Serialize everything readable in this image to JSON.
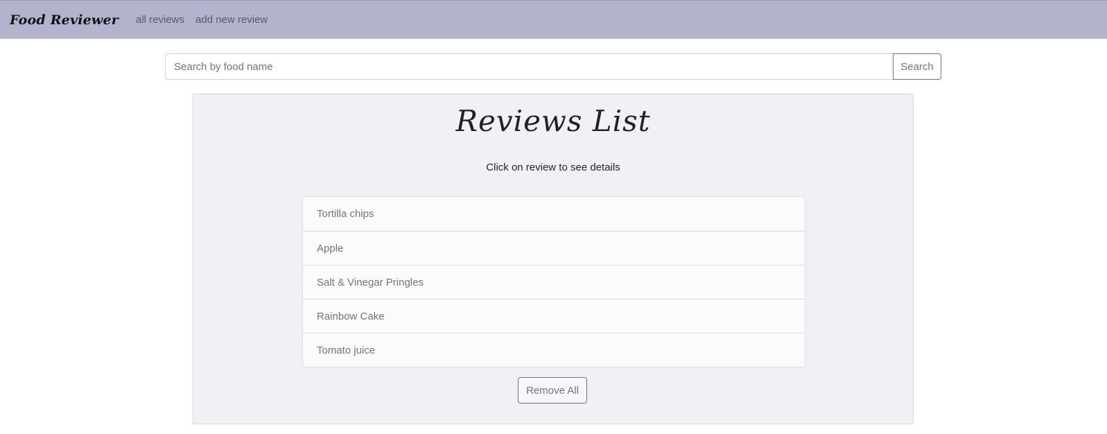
{
  "navbar": {
    "brand": "Food Reviewer",
    "links": [
      {
        "label": "all reviews"
      },
      {
        "label": "add new review"
      }
    ]
  },
  "search": {
    "placeholder": "Search by food name",
    "value": "",
    "button_label": "Search"
  },
  "main": {
    "title": "Reviews List",
    "subtitle": "Click on review to see details",
    "reviews": [
      {
        "label": "Tortilla chips"
      },
      {
        "label": "Apple"
      },
      {
        "label": "Salt & Vinegar Pringles"
      },
      {
        "label": "Rainbow Cake"
      },
      {
        "label": "Tomato juice"
      }
    ],
    "remove_all_label": "Remove All"
  },
  "colors": {
    "navbar_bg": "#b2b3cc",
    "panel_bg": "#f0f0f5",
    "muted_text": "#6c757d"
  }
}
